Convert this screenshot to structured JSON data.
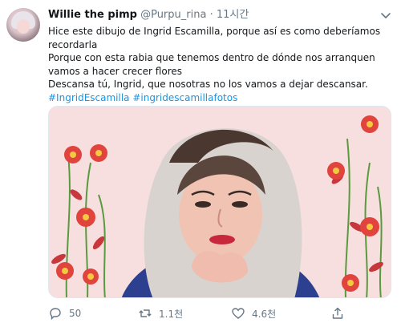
{
  "tweet": {
    "author_name": "Willie the pimp",
    "handle": "@Purpu_rina",
    "separator": "·",
    "time": "11시간",
    "lines": [
      "Hice este dibujo de Ingrid Escamilla,  porque así es como deberíamos",
      "recordarla",
      "Porque con esta rabia que tenemos dentro de dónde nos arranquen",
      "vamos a hacer crecer flores",
      "Descansa tú, Ingrid, que nosotras no los vamos a dejar descansar."
    ],
    "hashtags": [
      "#IngridEscamilla",
      "#ingridescamillafotos"
    ]
  },
  "actions": {
    "reply_count": "50",
    "retweet_count": "1.1천",
    "like_count": "4.6천"
  },
  "icons": {
    "menu": "chevron-down-icon",
    "reply": "reply-icon",
    "retweet": "retweet-icon",
    "like": "heart-icon",
    "share": "share-icon"
  },
  "colors": {
    "link": "#1b95e0",
    "secondary_text": "#657786",
    "media_background": "#f7dfe0"
  }
}
